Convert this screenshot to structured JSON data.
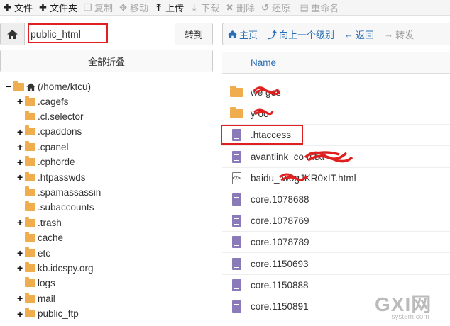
{
  "toolbar": {
    "items": [
      {
        "icon": "plus-icon",
        "label": "文件",
        "disabled": false
      },
      {
        "icon": "plus-icon",
        "label": "文件夹",
        "disabled": false
      },
      {
        "icon": "copy-icon",
        "label": "复制",
        "disabled": true
      },
      {
        "icon": "move-icon",
        "label": "移动",
        "disabled": true
      },
      {
        "icon": "upload-icon",
        "label": "上传",
        "disabled": false
      },
      {
        "icon": "download-icon",
        "label": "下载",
        "disabled": true
      },
      {
        "icon": "delete-icon",
        "label": "删除",
        "disabled": true
      },
      {
        "icon": "restore-icon",
        "label": "还原",
        "disabled": true
      },
      {
        "icon": "rename-icon",
        "label": "重命名",
        "disabled": true
      }
    ]
  },
  "path_bar": {
    "value": "public_html",
    "go_label": "转到"
  },
  "collapse_label": "全部折叠",
  "tree": {
    "root": "(/home/ktcu)",
    "items": [
      {
        "label": ".cagefs",
        "expandable": true
      },
      {
        "label": ".cl.selector",
        "expandable": false
      },
      {
        "label": ".cpaddons",
        "expandable": true
      },
      {
        "label": ".cpanel",
        "expandable": true
      },
      {
        "label": ".cphorde",
        "expandable": true
      },
      {
        "label": ".htpasswds",
        "expandable": true
      },
      {
        "label": ".spamassassin",
        "expandable": false
      },
      {
        "label": ".subaccounts",
        "expandable": false
      },
      {
        "label": ".trash",
        "expandable": true
      },
      {
        "label": "cache",
        "expandable": false
      },
      {
        "label": "etc",
        "expandable": true
      },
      {
        "label": "kb.idcspy.org",
        "expandable": true
      },
      {
        "label": "logs",
        "expandable": false
      },
      {
        "label": "mail",
        "expandable": true
      },
      {
        "label": "public_ftp",
        "expandable": true
      }
    ]
  },
  "nav": {
    "home": "主页",
    "up": "向上一个级别",
    "back": "返回",
    "forward": "转发"
  },
  "list": {
    "column": "Name",
    "files": [
      {
        "name": "we   ges",
        "type": "folder"
      },
      {
        "name": "y   oo",
        "type": "folder"
      },
      {
        "name": ".htaccess",
        "type": "doc"
      },
      {
        "name": "avantlink_co         n.txt",
        "type": "doc"
      },
      {
        "name": "baidu_      w0gJKR0xIT.html",
        "type": "html"
      },
      {
        "name": "core.1078688",
        "type": "doc"
      },
      {
        "name": "core.1078769",
        "type": "doc"
      },
      {
        "name": "core.1078789",
        "type": "doc"
      },
      {
        "name": "core.1150693",
        "type": "doc"
      },
      {
        "name": "core.1150888",
        "type": "doc"
      },
      {
        "name": "core.1150891",
        "type": "doc"
      }
    ]
  },
  "watermark": {
    "text": "GXI网",
    "sub": "system.com"
  },
  "colors": {
    "accent": "#2a6fb5",
    "folder": "#f0ad4e",
    "doc": "#8a7ab8",
    "highlight": "#e02020"
  }
}
